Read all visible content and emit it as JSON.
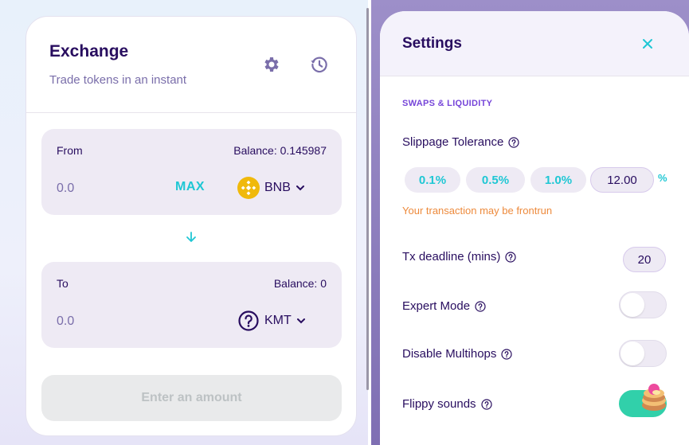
{
  "exchange": {
    "title": "Exchange",
    "subtitle": "Trade tokens in an instant",
    "from": {
      "label": "From",
      "balance": "Balance: 0.145987",
      "amount": "0.0",
      "max_label": "MAX",
      "token": "BNB",
      "token_icon": "bnb-icon"
    },
    "to": {
      "label": "To",
      "balance": "Balance: 0",
      "amount": "0.0",
      "token": "KMT",
      "token_icon": "question-circle-icon"
    },
    "enter_amount_label": "Enter an amount"
  },
  "settings": {
    "title": "Settings",
    "section_label": "SWAPS & LIQUIDITY",
    "slippage": {
      "label": "Slippage Tolerance",
      "options": [
        "0.1%",
        "0.5%",
        "1.0%"
      ],
      "custom_value": "12.00",
      "unit": "%",
      "warning": "Your transaction may be frontrun"
    },
    "tx_deadline": {
      "label": "Tx deadline (mins)",
      "value": "20"
    },
    "expert_mode": {
      "label": "Expert Mode",
      "on": false
    },
    "disable_multihops": {
      "label": "Disable Multihops",
      "on": false
    },
    "flippy_sounds": {
      "label": "Flippy sounds",
      "on": true
    }
  },
  "colors": {
    "primary_text": "#280d5f",
    "secondary_text": "#7a6eaa",
    "accent": "#1fc7d4",
    "success": "#31d0aa",
    "warning": "#ed8a3c",
    "secondary": "#7645d9"
  }
}
